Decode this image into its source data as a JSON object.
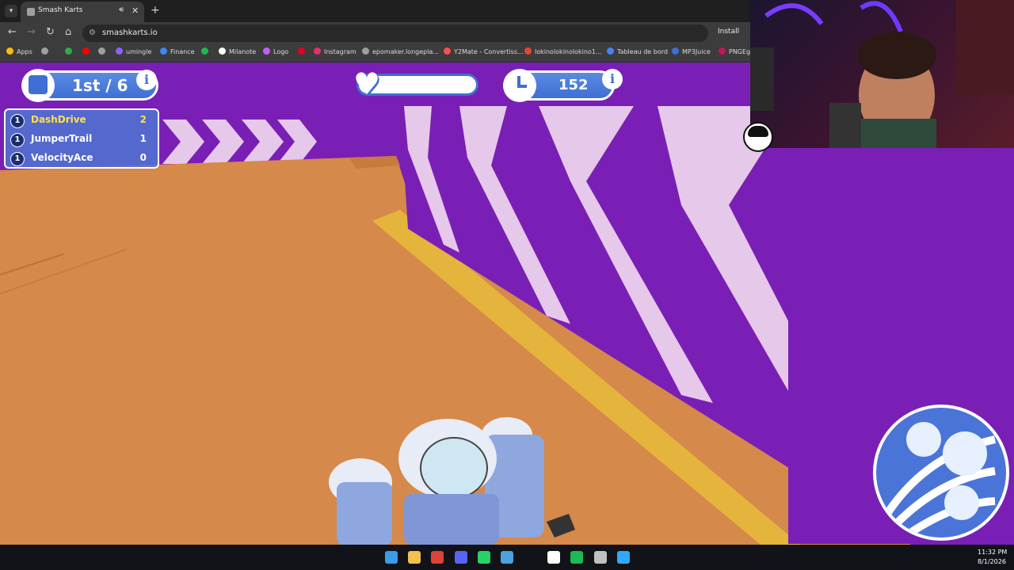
{
  "browser": {
    "tab_title": "Smash Karts",
    "new_tab_label": "+",
    "url": "smashkarts.io",
    "install_label": "Install",
    "bookmarks": [
      {
        "label": "Apps",
        "icon": "apps-grid-icon",
        "color": "#fbbc04"
      },
      {
        "label": "",
        "icon": "grid-icon",
        "color": "#9aa0a6"
      },
      {
        "label": "",
        "icon": "green-app-icon",
        "color": "#34a853"
      },
      {
        "label": "",
        "icon": "youtube-icon",
        "color": "#ff0000"
      },
      {
        "label": "",
        "icon": "globe-icon",
        "color": "#9aa0a6"
      },
      {
        "label": "umingle",
        "icon": "umingle-icon",
        "color": "#8a63ff"
      },
      {
        "label": "Finance",
        "icon": "finance-icon",
        "color": "#4285f4"
      },
      {
        "label": "",
        "icon": "spotify-icon",
        "color": "#1db954"
      },
      {
        "label": "Milanote",
        "icon": "milanote-icon",
        "color": "#ffffff"
      },
      {
        "label": "Logo",
        "icon": "logo-icon",
        "color": "#c060ff"
      },
      {
        "label": "",
        "icon": "pinterest-icon",
        "color": "#e60023"
      },
      {
        "label": "Instagram",
        "icon": "instagram-icon",
        "color": "#e1306c"
      },
      {
        "label": "epomaker.longepla...",
        "icon": "globe-icon",
        "color": "#9aa0a6"
      },
      {
        "label": "Y2Mate - Convertiss...",
        "icon": "y2mate-icon",
        "color": "#ff4d4d"
      },
      {
        "label": "lokinolokinolokino1...",
        "icon": "gmail-icon",
        "color": "#ea4335"
      },
      {
        "label": "Tableau de bord",
        "icon": "tableau-icon",
        "color": "#4285f4"
      },
      {
        "label": "MP3Juice",
        "icon": "mp3juice-icon",
        "color": "#3f6fd4"
      },
      {
        "label": "PNGEgg",
        "icon": "pngegg-icon",
        "color": "#c2185b"
      }
    ]
  },
  "hud": {
    "rank": "1st / 6",
    "time": "152",
    "info_label": "i",
    "health_fraction": 1.0,
    "scoreboard": [
      {
        "rank": "1",
        "name": "DashDrive",
        "score": "2",
        "is_player": true
      },
      {
        "rank": "1",
        "name": "JumperTrail",
        "score": "1",
        "is_player": false
      },
      {
        "rank": "1",
        "name": "VelocityAce",
        "score": "0",
        "is_player": false
      }
    ]
  },
  "taskbar": {
    "time": "11:32 PM",
    "date": "8/1/2026",
    "apps": [
      "windows-start-icon",
      "file-explorer-icon",
      "chrome-icon",
      "discord-icon",
      "whatsapp-icon",
      "notepad-icon",
      "capcut-icon",
      "spotify-icon",
      "steam-icon",
      "photoshop-icon"
    ]
  },
  "colors": {
    "track_orange": "#d5894a",
    "wall_purple": "#7a1fb5",
    "stripe_light": "#e6c8ea",
    "lane_yellow": "#e5b43c",
    "hud_blue": "#3f6fd4",
    "highlight_yellow": "#ffe14a"
  }
}
